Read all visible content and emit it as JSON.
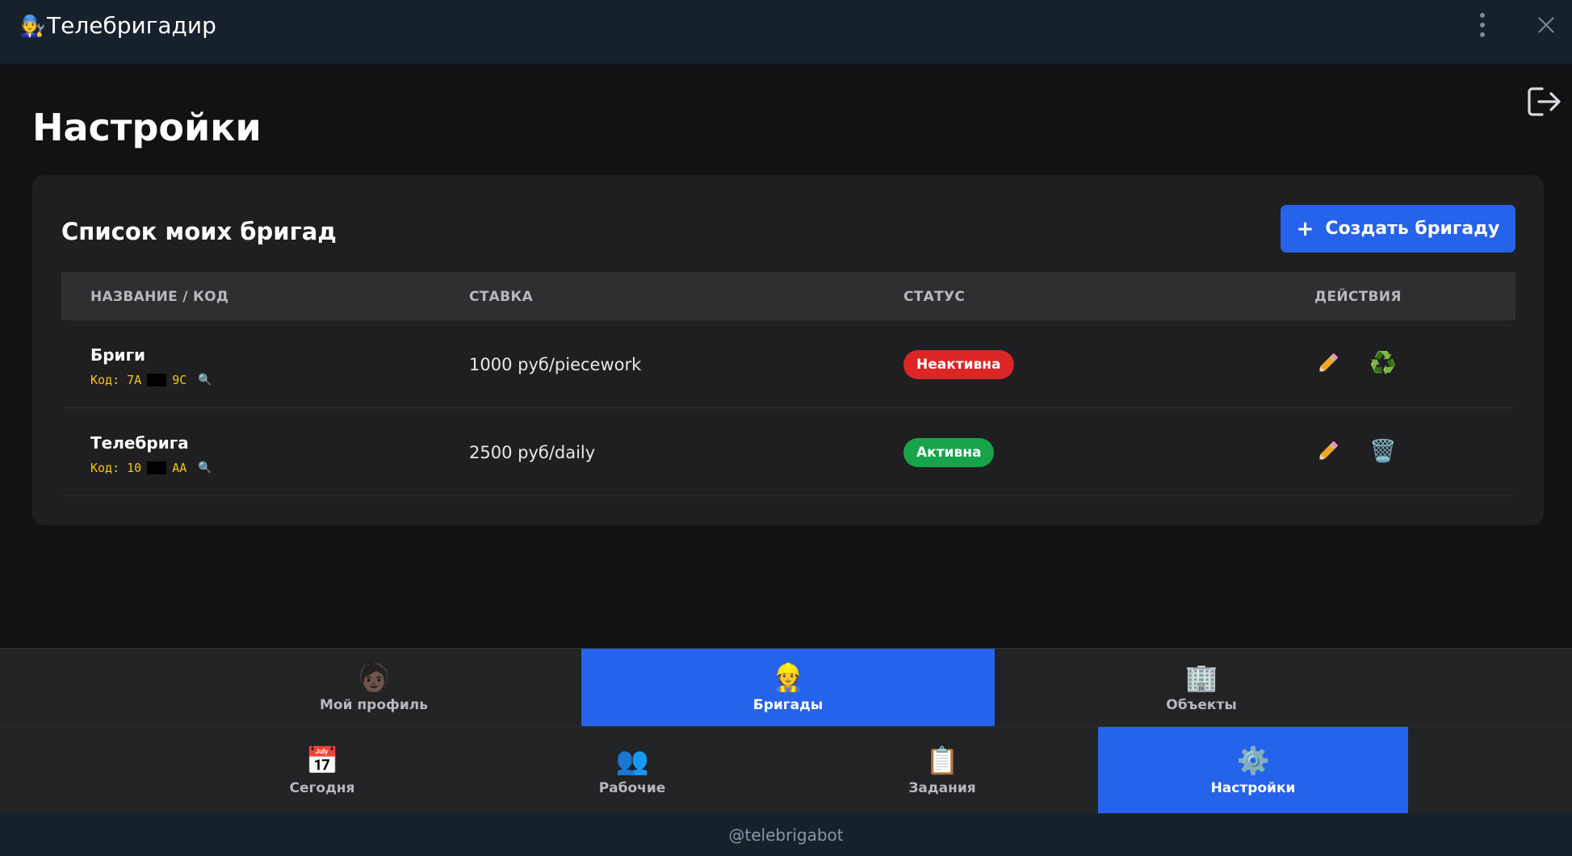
{
  "window": {
    "app_icon": "🧑‍🔧",
    "title": "Телебригадир"
  },
  "page": {
    "title": "Настройки"
  },
  "brigades_card": {
    "title": "Список моих бригад",
    "create_button": {
      "plus": "+",
      "label": "Создать бригаду"
    },
    "columns": [
      "НАЗВАНИЕ / КОД",
      "СТАВКА",
      "СТАТУС",
      "ДЕЙСТВИЯ"
    ],
    "rows": [
      {
        "name": "Бриги",
        "code_prefix": "Код: 7A",
        "code_suffix": "9C",
        "rate": "1000 руб/piecework",
        "status": "Неактивна",
        "status_color": "#dc2626",
        "second_action_icon": "♻️"
      },
      {
        "name": "Телебрига",
        "code_prefix": "Код: 10",
        "code_suffix": "AA",
        "rate": "2500 руб/daily",
        "status": "Активна",
        "status_color": "#16a34a",
        "second_action_icon": "🗑️"
      }
    ]
  },
  "nav_top": [
    {
      "icon": "🧑🏿",
      "label": "Мой профиль",
      "selected": false
    },
    {
      "icon": "👷",
      "label": "Бригады",
      "selected": true
    },
    {
      "icon": "🏢",
      "label": "Объекты",
      "selected": false
    }
  ],
  "nav_bottom": [
    {
      "icon": "📅",
      "label": "Сегодня",
      "selected": false
    },
    {
      "icon": "👥",
      "label": "Рабочие",
      "selected": false
    },
    {
      "icon": "📋",
      "label": "Задания",
      "selected": false
    },
    {
      "icon": "⚙️",
      "label": "Настройки",
      "selected": true
    }
  ],
  "footer": {
    "text": "@telebrigabot"
  },
  "colors": {
    "accent": "#2563eb",
    "code": "#f5c518",
    "background": "#111214",
    "card": "#1f1f21"
  }
}
